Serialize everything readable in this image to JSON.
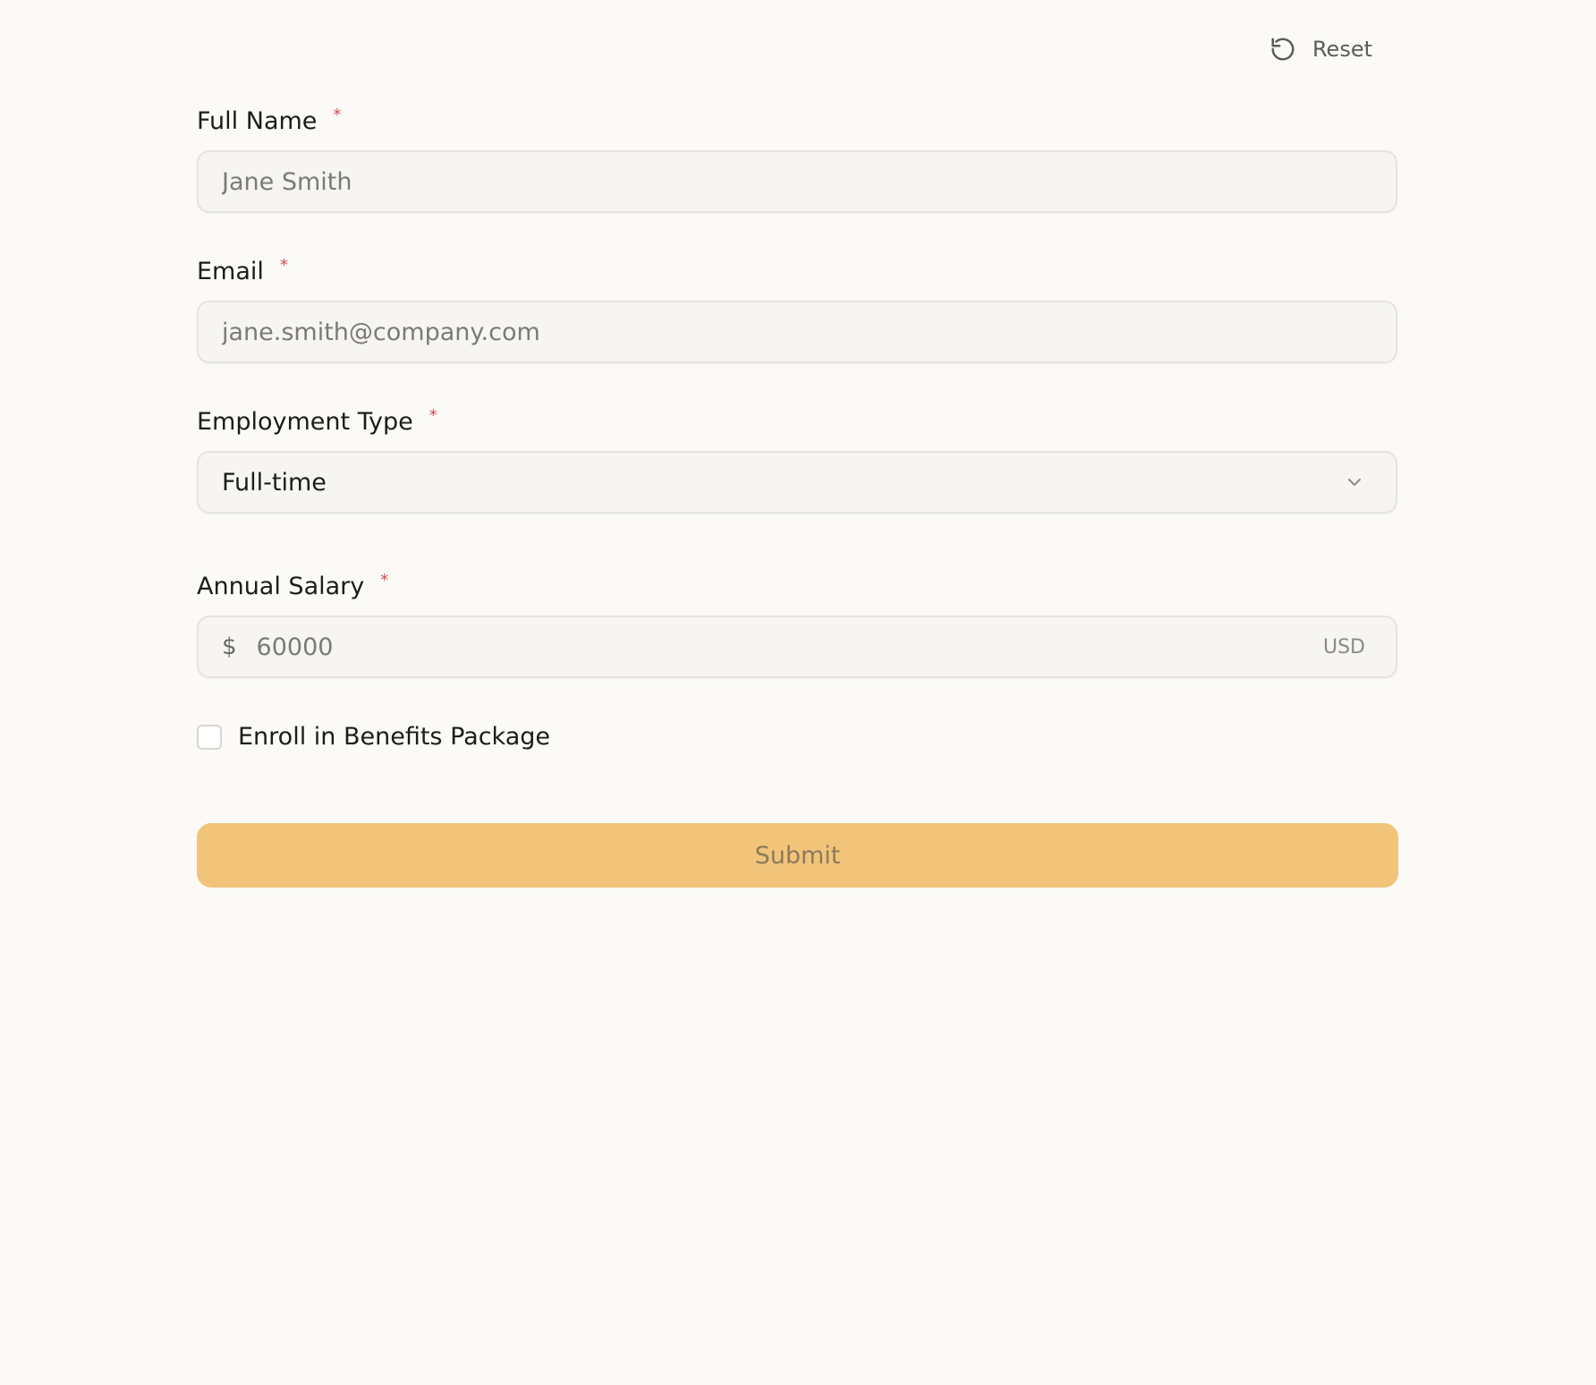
{
  "header": {
    "reset_label": "Reset"
  },
  "form": {
    "full_name": {
      "label": "Full Name",
      "required_mark": "*",
      "placeholder": "Jane Smith",
      "value": ""
    },
    "email": {
      "label": "Email",
      "required_mark": "*",
      "placeholder": "jane.smith@company.com",
      "value": ""
    },
    "employment_type": {
      "label": "Employment Type",
      "required_mark": "*",
      "selected": "Full-time"
    },
    "annual_salary": {
      "label": "Annual Salary",
      "required_mark": "*",
      "prefix": "$",
      "placeholder": "60000",
      "value": "",
      "suffix": "USD"
    },
    "benefits": {
      "label": "Enroll in Benefits Package",
      "checked": false
    },
    "submit_label": "Submit"
  },
  "colors": {
    "background": "#fbfaf7",
    "input_background": "#f6f5f1",
    "required": "#d34a55",
    "submit_background": "#f1c47a",
    "submit_text": "#8d7a5c"
  },
  "icons": {
    "reset": "rotate-ccw-icon",
    "select": "chevron-down-icon"
  }
}
